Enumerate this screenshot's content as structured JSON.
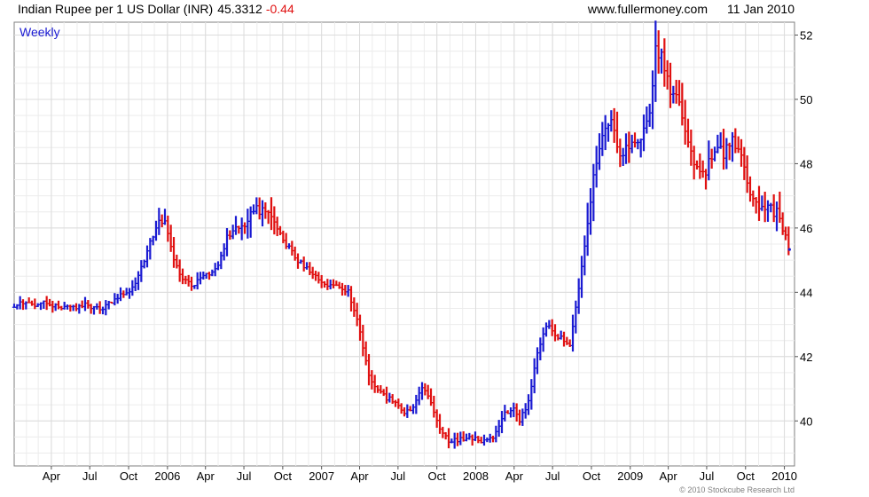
{
  "header": {
    "title": "Indian Rupee per 1 US Dollar (INR)",
    "last": "45.3312",
    "change": "-0.44",
    "site": "www.fullermoney.com",
    "date": "11 Jan 2010"
  },
  "footer": {
    "copyright": "© 2010 Stockcube Research Ltd"
  },
  "colors": {
    "up": "#1a1ad2",
    "down": "#e01010",
    "grid": "#dcdcdc",
    "change": "#e01010",
    "interval": "#1a1ad2"
  },
  "chart_data": {
    "type": "ohlc",
    "interval_label": "Weekly",
    "y_axis": {
      "ticks": [
        40,
        42,
        44,
        46,
        48,
        50,
        52
      ],
      "range": [
        38.6,
        52.4
      ],
      "side": "right"
    },
    "x_axis": {
      "ticks": [
        {
          "label": "Apr",
          "date": "2005-04-01"
        },
        {
          "label": "Jul",
          "date": "2005-07-01"
        },
        {
          "label": "Oct",
          "date": "2005-10-01"
        },
        {
          "label": "2006",
          "date": "2006-01-01"
        },
        {
          "label": "Apr",
          "date": "2006-04-01"
        },
        {
          "label": "Jul",
          "date": "2006-07-01"
        },
        {
          "label": "Oct",
          "date": "2006-10-01"
        },
        {
          "label": "2007",
          "date": "2007-01-01"
        },
        {
          "label": "Apr",
          "date": "2007-04-01"
        },
        {
          "label": "Jul",
          "date": "2007-07-01"
        },
        {
          "label": "Oct",
          "date": "2007-10-01"
        },
        {
          "label": "2008",
          "date": "2008-01-01"
        },
        {
          "label": "Apr",
          "date": "2008-04-01"
        },
        {
          "label": "Jul",
          "date": "2008-07-01"
        },
        {
          "label": "Oct",
          "date": "2008-10-01"
        },
        {
          "label": "2009",
          "date": "2009-01-01"
        },
        {
          "label": "Apr",
          "date": "2009-04-01"
        },
        {
          "label": "Jul",
          "date": "2009-07-01"
        },
        {
          "label": "Oct",
          "date": "2009-10-01"
        },
        {
          "label": "2010",
          "date": "2010-01-01"
        }
      ],
      "range": [
        "2005-01-03",
        "2010-01-25"
      ]
    },
    "grid": true,
    "close_series": [
      [
        "2005-01-03",
        43.6
      ],
      [
        "2005-01-24",
        43.7
      ],
      [
        "2005-02-14",
        43.6
      ],
      [
        "2005-03-07",
        43.7
      ],
      [
        "2005-03-28",
        43.6
      ],
      [
        "2005-04-18",
        43.6
      ],
      [
        "2005-05-09",
        43.5
      ],
      [
        "2005-05-30",
        43.5
      ],
      [
        "2005-06-20",
        43.6
      ],
      [
        "2005-07-11",
        43.5
      ],
      [
        "2005-08-01",
        43.5
      ],
      [
        "2005-08-22",
        43.7
      ],
      [
        "2005-09-12",
        43.9
      ],
      [
        "2005-10-03",
        44.0
      ],
      [
        "2005-10-24",
        44.5
      ],
      [
        "2005-11-14",
        45.3
      ],
      [
        "2005-12-05",
        46.0
      ],
      [
        "2005-12-19",
        46.3
      ],
      [
        "2006-01-02",
        45.8
      ],
      [
        "2006-01-16",
        45.0
      ],
      [
        "2006-02-06",
        44.4
      ],
      [
        "2006-02-27",
        44.2
      ],
      [
        "2006-03-20",
        44.4
      ],
      [
        "2006-04-10",
        44.6
      ],
      [
        "2006-05-01",
        44.8
      ],
      [
        "2006-05-22",
        45.7
      ],
      [
        "2006-06-12",
        46.0
      ],
      [
        "2006-07-03",
        46.0
      ],
      [
        "2006-07-24",
        46.6
      ],
      [
        "2006-08-07",
        46.6
      ],
      [
        "2006-08-28",
        46.5
      ],
      [
        "2006-09-18",
        45.9
      ],
      [
        "2006-10-09",
        45.5
      ],
      [
        "2006-10-30",
        45.1
      ],
      [
        "2006-11-20",
        44.8
      ],
      [
        "2006-12-11",
        44.6
      ],
      [
        "2007-01-01",
        44.3
      ],
      [
        "2007-01-22",
        44.2
      ],
      [
        "2007-02-12",
        44.2
      ],
      [
        "2007-03-05",
        44.0
      ],
      [
        "2007-03-19",
        43.4
      ],
      [
        "2007-04-02",
        42.8
      ],
      [
        "2007-04-23",
        41.4
      ],
      [
        "2007-05-14",
        40.9
      ],
      [
        "2007-06-04",
        40.7
      ],
      [
        "2007-06-25",
        40.6
      ],
      [
        "2007-07-16",
        40.3
      ],
      [
        "2007-08-06",
        40.4
      ],
      [
        "2007-08-27",
        41.0
      ],
      [
        "2007-09-17",
        40.6
      ],
      [
        "2007-10-08",
        39.7
      ],
      [
        "2007-10-29",
        39.4
      ],
      [
        "2007-11-19",
        39.4
      ],
      [
        "2007-12-10",
        39.5
      ],
      [
        "2008-01-07",
        39.4
      ],
      [
        "2008-01-28",
        39.4
      ],
      [
        "2008-02-18",
        39.6
      ],
      [
        "2008-03-10",
        40.2
      ],
      [
        "2008-03-31",
        40.4
      ],
      [
        "2008-04-14",
        40.0
      ],
      [
        "2008-05-05",
        40.6
      ],
      [
        "2008-05-26",
        42.1
      ],
      [
        "2008-06-16",
        43.0
      ],
      [
        "2008-07-07",
        42.7
      ],
      [
        "2008-07-28",
        42.5
      ],
      [
        "2008-08-11",
        42.3
      ],
      [
        "2008-08-25",
        43.5
      ],
      [
        "2008-09-15",
        45.5
      ],
      [
        "2008-10-06",
        47.5
      ],
      [
        "2008-10-27",
        48.8
      ],
      [
        "2008-11-17",
        49.5
      ],
      [
        "2008-12-08",
        48.2
      ],
      [
        "2009-01-05",
        48.7
      ],
      [
        "2009-01-26",
        48.8
      ],
      [
        "2009-02-16",
        49.6
      ],
      [
        "2009-03-02",
        51.5
      ],
      [
        "2009-03-16",
        51.3
      ],
      [
        "2009-04-06",
        50.2
      ],
      [
        "2009-04-27",
        50.0
      ],
      [
        "2009-05-18",
        48.6
      ],
      [
        "2009-06-08",
        47.8
      ],
      [
        "2009-06-29",
        47.8
      ],
      [
        "2009-07-20",
        48.5
      ],
      [
        "2009-08-10",
        48.3
      ],
      [
        "2009-08-31",
        48.8
      ],
      [
        "2009-09-21",
        48.2
      ],
      [
        "2009-10-12",
        46.9
      ],
      [
        "2009-11-02",
        46.6
      ],
      [
        "2009-11-23",
        46.6
      ],
      [
        "2009-12-14",
        46.5
      ],
      [
        "2010-01-04",
        45.8
      ],
      [
        "2010-01-11",
        45.33
      ]
    ]
  }
}
